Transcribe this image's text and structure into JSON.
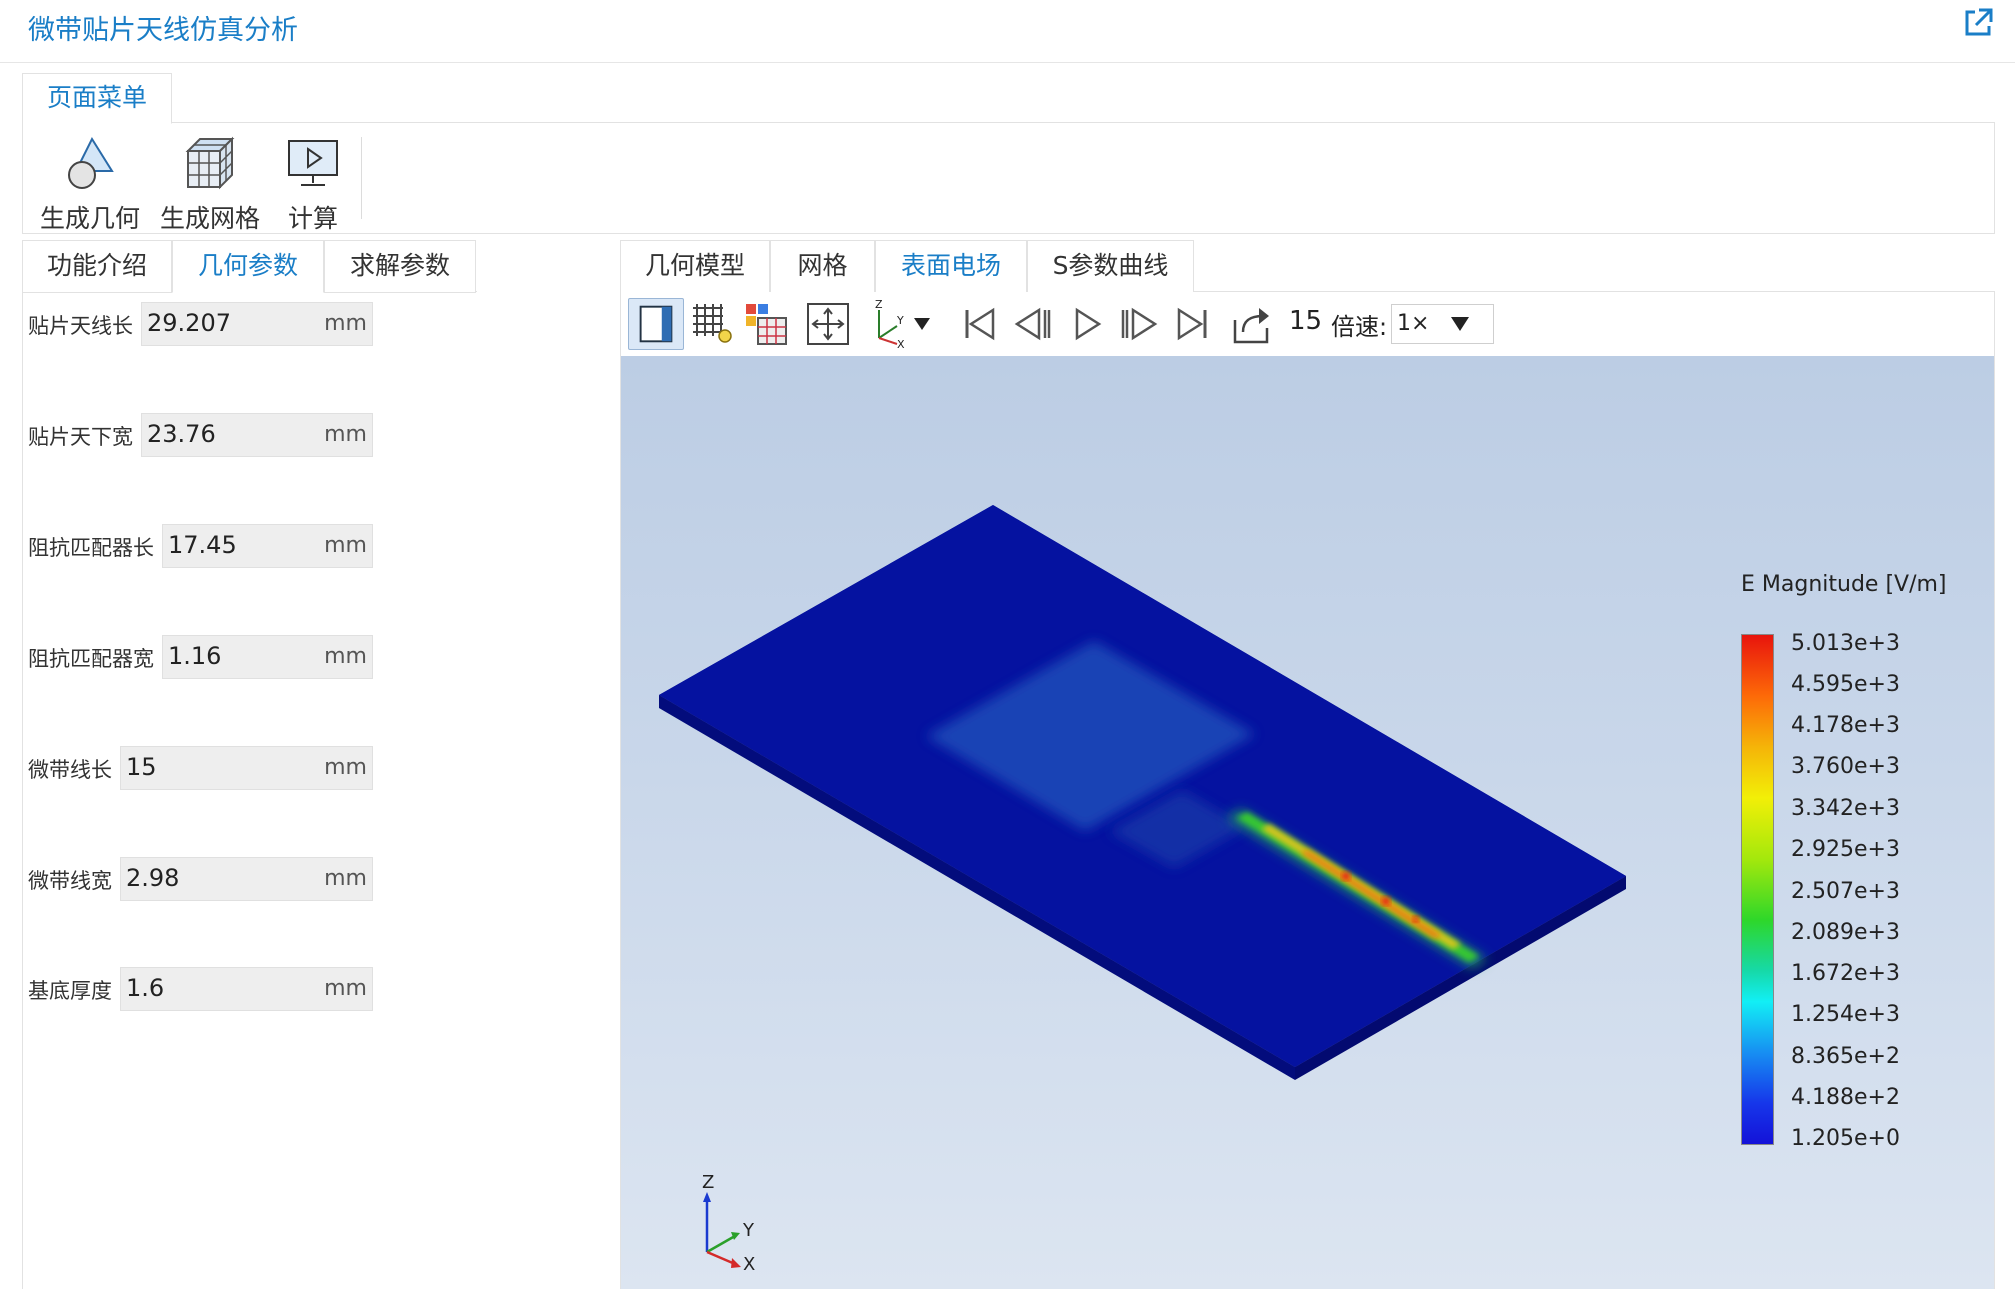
{
  "app": {
    "title": "微带贴片天线仿真分析"
  },
  "menu_tab": "页面菜单",
  "ribbon": {
    "geometry_button": "生成几何",
    "mesh_button": "生成网格",
    "compute_button": "计算"
  },
  "left_tabs": [
    "功能介绍",
    "几何参数",
    "求解参数"
  ],
  "left_active_tab": "几何参数",
  "params": [
    {
      "label": "贴片天线长",
      "value": "29.207",
      "unit": "mm"
    },
    {
      "label": "贴片天下宽",
      "value": "23.76",
      "unit": "mm"
    },
    {
      "label": "阻抗匹配器长",
      "value": "17.45",
      "unit": "mm"
    },
    {
      "label": "阻抗匹配器宽",
      "value": "1.16",
      "unit": "mm"
    },
    {
      "label": "微带线长",
      "value": "15",
      "unit": "mm"
    },
    {
      "label": "微带线宽",
      "value": "2.98",
      "unit": "mm"
    },
    {
      "label": "基底厚度",
      "value": "1.6",
      "unit": "mm"
    }
  ],
  "right_tabs": [
    "几何模型",
    "网格",
    "表面电场",
    "S参数曲线"
  ],
  "right_active_tab": "表面电场",
  "toolbar": {
    "frame": "15",
    "speed_label": "倍速:",
    "speed_value": "1×",
    "axis_labels": [
      "Z",
      "Y",
      "X"
    ]
  },
  "legend": {
    "title": "E Magnitude [V/m]",
    "ticks": [
      "5.013e+3",
      "4.595e+3",
      "4.178e+3",
      "3.760e+3",
      "3.342e+3",
      "2.925e+3",
      "2.507e+3",
      "2.089e+3",
      "1.672e+3",
      "1.254e+3",
      "8.365e+2",
      "4.188e+2",
      "1.205e+0"
    ]
  },
  "triad": {
    "z": "Z",
    "y": "Y",
    "x": "X"
  },
  "colors": {
    "accent": "#1a7ec7",
    "substrate": "#0512a0",
    "hot": "#e8140d"
  }
}
